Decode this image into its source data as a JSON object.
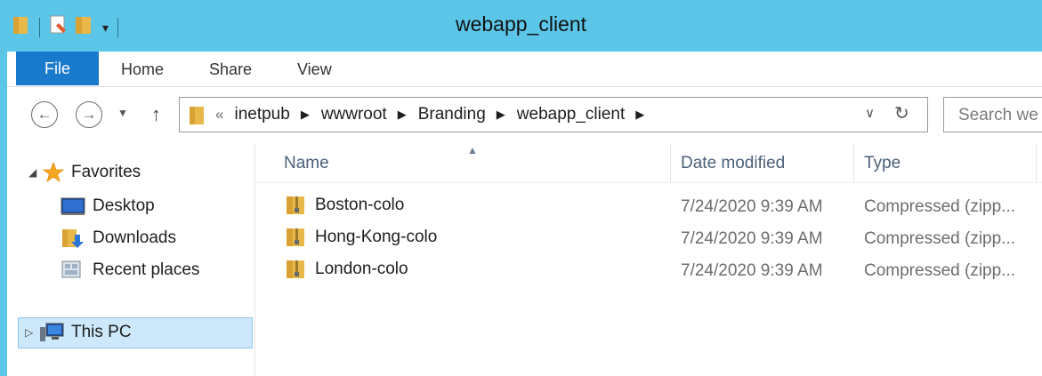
{
  "window": {
    "title": "webapp_client"
  },
  "ribbon": {
    "tabs": [
      {
        "label": "File"
      },
      {
        "label": "Home"
      },
      {
        "label": "Share"
      },
      {
        "label": "View"
      }
    ]
  },
  "address": {
    "overflow": "«",
    "crumbs": [
      "inetpub",
      "wwwroot",
      "Branding",
      "webapp_client"
    ]
  },
  "search": {
    "placeholder": "Search we"
  },
  "navpane": {
    "favorites": "Favorites",
    "items": [
      {
        "label": "Desktop",
        "icon": "desktop-icon"
      },
      {
        "label": "Downloads",
        "icon": "downloads-icon"
      },
      {
        "label": "Recent places",
        "icon": "recent-places-icon"
      }
    ],
    "this_pc": "This PC"
  },
  "content": {
    "columns": {
      "name": "Name",
      "date": "Date modified",
      "type": "Type"
    },
    "files": [
      {
        "name": "Boston-colo",
        "date": "7/24/2020 9:39 AM",
        "type": "Compressed (zipp..."
      },
      {
        "name": "Hong-Kong-colo",
        "date": "7/24/2020 9:39 AM",
        "type": "Compressed (zipp..."
      },
      {
        "name": "London-colo",
        "date": "7/24/2020 9:39 AM",
        "type": "Compressed (zipp..."
      }
    ]
  },
  "colors": {
    "titlebar": "#5cc6e8",
    "file_tab": "#1979ca",
    "selection": "#cce8fa"
  }
}
